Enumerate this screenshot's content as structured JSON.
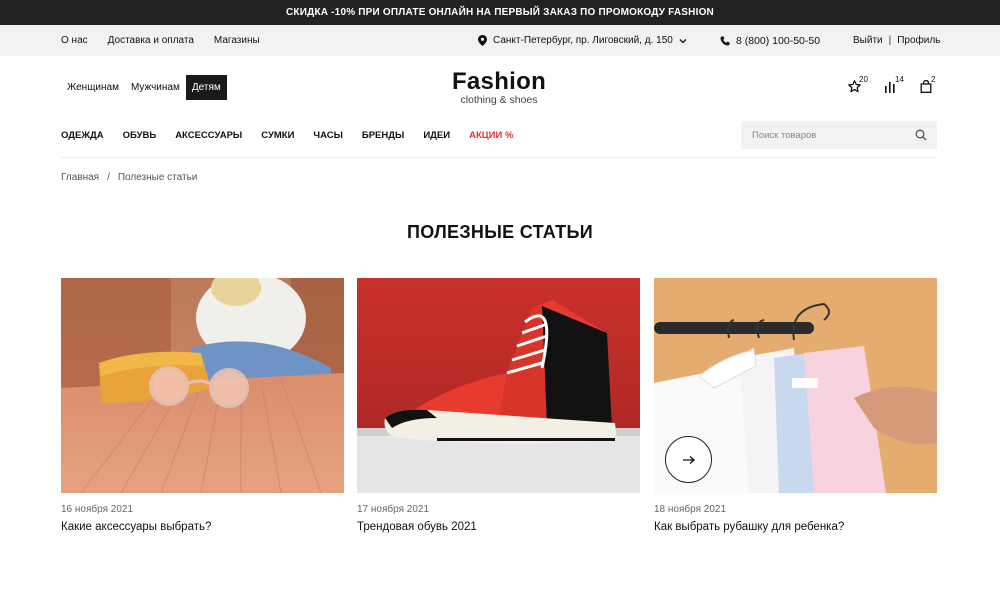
{
  "promo": {
    "text": "СКИДКА -10% ПРИ ОПЛАТЕ ОНЛАЙН НА ПЕРВЫЙ ЗАКАЗ ПО ПРОМОКОДУ FASHION"
  },
  "topbar": {
    "links": [
      "О нас",
      "Доставка и оплата",
      "Магазины"
    ],
    "location": "Санкт-Петербург, пр. Лиговский, д. 150",
    "phone": "8 (800) 100-50-50",
    "logout": "Выйти",
    "separator": "|",
    "profile": "Профиль"
  },
  "gender": {
    "items": [
      "Женщинам",
      "Мужчинам",
      "Детям"
    ],
    "active_index": 2
  },
  "logo": {
    "name": "Fashion",
    "tagline": "clothing & shoes"
  },
  "user_icons": {
    "favorites": {
      "icon": "star-icon",
      "count": "20"
    },
    "compare": {
      "icon": "compare-icon",
      "count": "14"
    },
    "cart": {
      "icon": "bag-icon",
      "count": "2"
    }
  },
  "nav": {
    "items": [
      "ОДЕЖДА",
      "ОБУВЬ",
      "АКСЕССУАРЫ",
      "СУМКИ",
      "ЧАСЫ",
      "БРЕНДЫ",
      "ИДЕИ"
    ],
    "sale": "АКЦИИ %",
    "sale_color": "#e33131"
  },
  "search": {
    "placeholder": "Поиск товаров",
    "value": ""
  },
  "breadcrumb": {
    "home": "Главная",
    "separator": "/",
    "current": "Полезные статьи"
  },
  "page_title": "ПОЛЕЗНЫЕ СТАТЬИ",
  "articles": [
    {
      "date": "16 ноября 2021",
      "title": "Какие аксессуары выбрать?",
      "image": "sunglasses-photo"
    },
    {
      "date": "17 ноября 2021",
      "title": "Трендовая обувь 2021",
      "image": "sneaker-photo"
    },
    {
      "date": "18 ноября 2021",
      "title": "Как выбрать рубашку для ребенка?",
      "image": "shirts-photo"
    }
  ],
  "next_button_icon": "arrow-right-icon"
}
